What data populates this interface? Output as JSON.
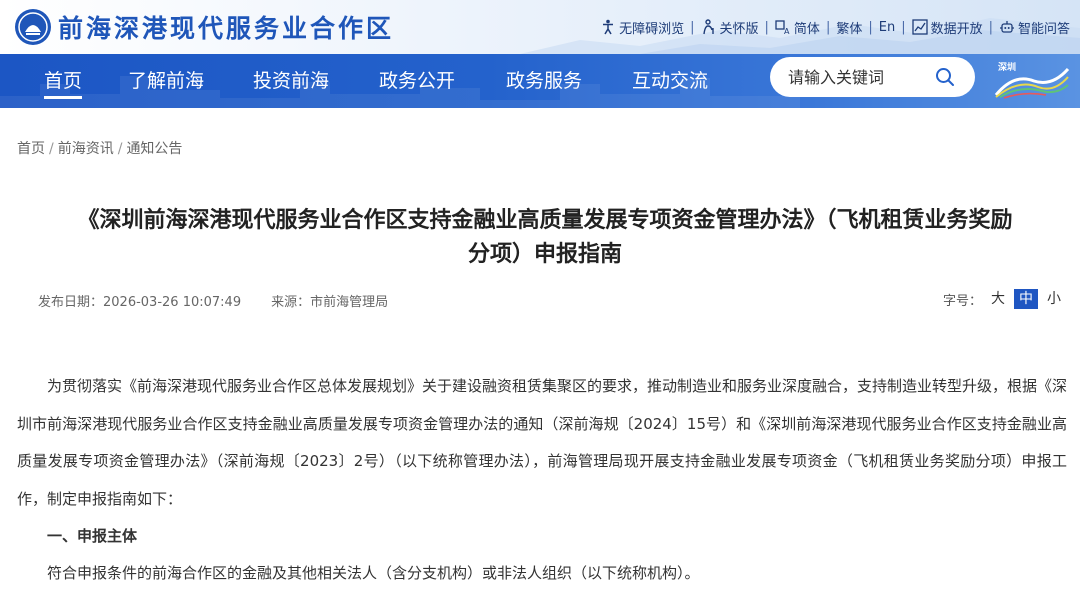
{
  "site": {
    "name": "前海深港现代服务业合作区",
    "utility": [
      {
        "icon": "accessibility-icon",
        "label": "无障碍浏览"
      },
      {
        "icon": "elder-care-icon",
        "label": "关怀版"
      },
      {
        "icon": "language-icon",
        "label": "简体"
      },
      {
        "icon": "",
        "label": "繁体"
      },
      {
        "icon": "",
        "label": "En"
      },
      {
        "icon": "data-chart-icon",
        "label": "数据开放"
      },
      {
        "icon": "robot-icon",
        "label": "智能问答"
      }
    ]
  },
  "nav": {
    "items": [
      "首页",
      "了解前海",
      "投资前海",
      "政务公开",
      "政务服务",
      "互动交流"
    ],
    "search_placeholder": "请输入关键词",
    "partner_logo_text": "深圳"
  },
  "breadcrumb": [
    "首页",
    "前海资讯",
    "通知公告"
  ],
  "article": {
    "title_line1": "《深圳前海深港现代服务业合作区支持金融业高质量发展专项资金管理办法》（飞机租赁业务奖励",
    "title_line2": "分项）申报指南",
    "date_label": "发布日期：",
    "date": "2026-03-26 10:07:49",
    "source_label": "来源：",
    "source": "市前海管理局",
    "font_size_label": "字号：",
    "font_sizes": [
      "大",
      "中",
      "小"
    ],
    "active_font_size": "中",
    "paragraph1": "为贯彻落实《前海深港现代服务业合作区总体发展规划》关于建设融资租赁集聚区的要求，推动制造业和服务业深度融合，支持制造业转型升级，根据《深圳市前海深港现代服务业合作区支持金融业高质量发展专项资金管理办法的通知（深前海规〔2024〕15号）和《深圳前海深港现代服务业合作区支持金融业高质量发展专项资金管理办法》（深前海规〔2023〕2号）（以下统称管理办法），前海管理局现开展支持金融业发展专项资金（飞机租赁业务奖励分项）申报工作，制定申报指南如下：",
    "heading1": "一、申报主体",
    "paragraph2": "符合申报条件的前海合作区的金融及其他相关法人（含分支机构）或非法人组织（以下统称机构）。"
  },
  "colors": {
    "brand_blue": "#1f56b9",
    "nav_blue": "#2462cc",
    "active_font_bg": "#1f56c2"
  }
}
